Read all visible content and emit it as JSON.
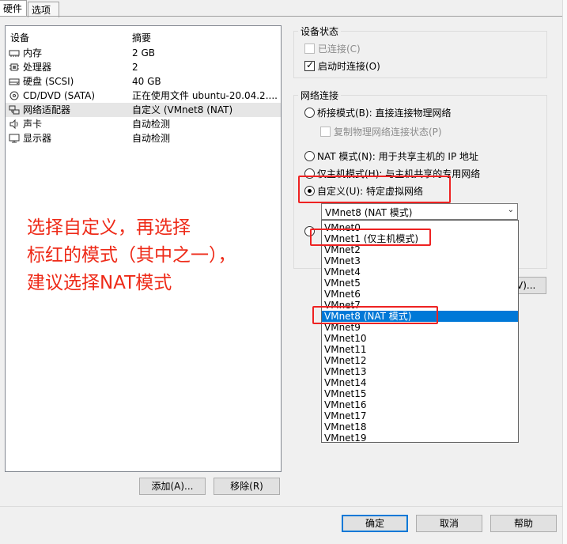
{
  "tabs": [
    "硬件",
    "选项"
  ],
  "device_table": {
    "headers": [
      "设备",
      "摘要"
    ],
    "rows": [
      {
        "icon": "memory-icon",
        "name": "内存",
        "summary": "2 GB"
      },
      {
        "icon": "cpu-icon",
        "name": "处理器",
        "summary": "2"
      },
      {
        "icon": "harddisk-icon",
        "name": "硬盘 (SCSI)",
        "summary": "40 GB"
      },
      {
        "icon": "cdrom-icon",
        "name": "CD/DVD (SATA)",
        "summary": "正在使用文件 ubuntu-20.04.2...."
      },
      {
        "icon": "network-adapter-icon",
        "name": "网络适配器",
        "summary": "自定义 (VMnet8 (NAT)"
      },
      {
        "icon": "sound-icon",
        "name": "声卡",
        "summary": "自动检测"
      },
      {
        "icon": "display-icon",
        "name": "显示器",
        "summary": "自动检测"
      }
    ],
    "selected_index": 4
  },
  "buttons": {
    "add": "添加(A)...",
    "remove": "移除(R)",
    "ok": "确定",
    "cancel": "取消",
    "help": "帮助",
    "partial": "V)..."
  },
  "device_status": {
    "title": "设备状态",
    "connected": {
      "label": "已连接(C)",
      "checked": false,
      "disabled": true
    },
    "connect_at_power_on": {
      "label": "启动时连接(O)",
      "checked": true
    }
  },
  "network": {
    "title": "网络连接",
    "bridged": {
      "label": "桥接模式(B): 直接连接物理网络"
    },
    "replicate": {
      "label": "复制物理网络连接状态(P)"
    },
    "nat": {
      "label": "NAT 模式(N): 用于共享主机的 IP 地址"
    },
    "host_only": {
      "label": "仅主机模式(H): 与主机共享的专用网络"
    },
    "custom": {
      "label": "自定义(U): 特定虚拟网络",
      "selected": true
    },
    "combo_value": "VMnet8 (NAT 模式)",
    "options": [
      "VMnet0",
      "VMnet1 (仅主机模式)",
      "VMnet2",
      "VMnet3",
      "VMnet4",
      "VMnet5",
      "VMnet6",
      "VMnet7",
      "VMnet8 (NAT 模式)",
      "VMnet9",
      "VMnet10",
      "VMnet11",
      "VMnet12",
      "VMnet13",
      "VMnet14",
      "VMnet15",
      "VMnet16",
      "VMnet17",
      "VMnet18",
      "VMnet19"
    ],
    "highlighted_index": 8
  },
  "annotation": {
    "line1": "选择自定义，再选择",
    "line2": "标红的模式（其中之一），",
    "line3": "建议选择NAT模式"
  },
  "colors": {
    "highlight": "#0078d7",
    "annotation_red": "#ee2a18"
  }
}
